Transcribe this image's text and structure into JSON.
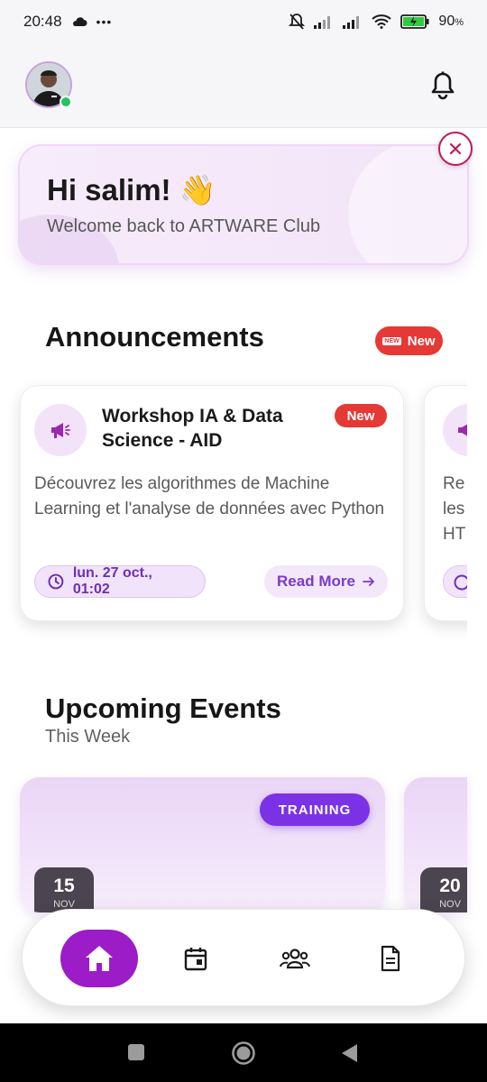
{
  "status_bar": {
    "time": "20:48",
    "dots": "•••",
    "battery": "90"
  },
  "user": {
    "greeting": "Hi salim! 👋",
    "welcome": "Welcome back to ARTWARE Club"
  },
  "announcements": {
    "title": "Announcements",
    "badge": "New",
    "badge_tag": "NEW",
    "items": [
      {
        "title": "Workshop IA & Data Science - AID",
        "badge": "New",
        "description": "Découvrez les algorithmes de Machine Learning et l'analyse de données avec Python",
        "date": "lun. 27 oct., 01:02",
        "action": "Read More"
      },
      {
        "preview_text": "Re\nles\nHT"
      }
    ]
  },
  "events": {
    "title": "Upcoming Events",
    "subtitle": "This Week",
    "items": [
      {
        "tag": "TRAINING",
        "day": "15",
        "month": "NOV"
      },
      {
        "day": "20",
        "month": "NOV"
      }
    ]
  },
  "colors": {
    "accent": "#9c1cc8",
    "purple": "#7b32e6",
    "badge_red": "#e53935",
    "online": "#22c55e"
  },
  "icons": {
    "status": [
      "cloud-icon",
      "mute-bell-icon",
      "signal-icon",
      "signal-icon",
      "wifi-icon",
      "battery-charging-icon"
    ],
    "nav": [
      "home-icon",
      "calendar-icon",
      "users-icon",
      "document-icon"
    ],
    "android": [
      "recents-icon",
      "home-circle-icon",
      "back-icon"
    ]
  }
}
